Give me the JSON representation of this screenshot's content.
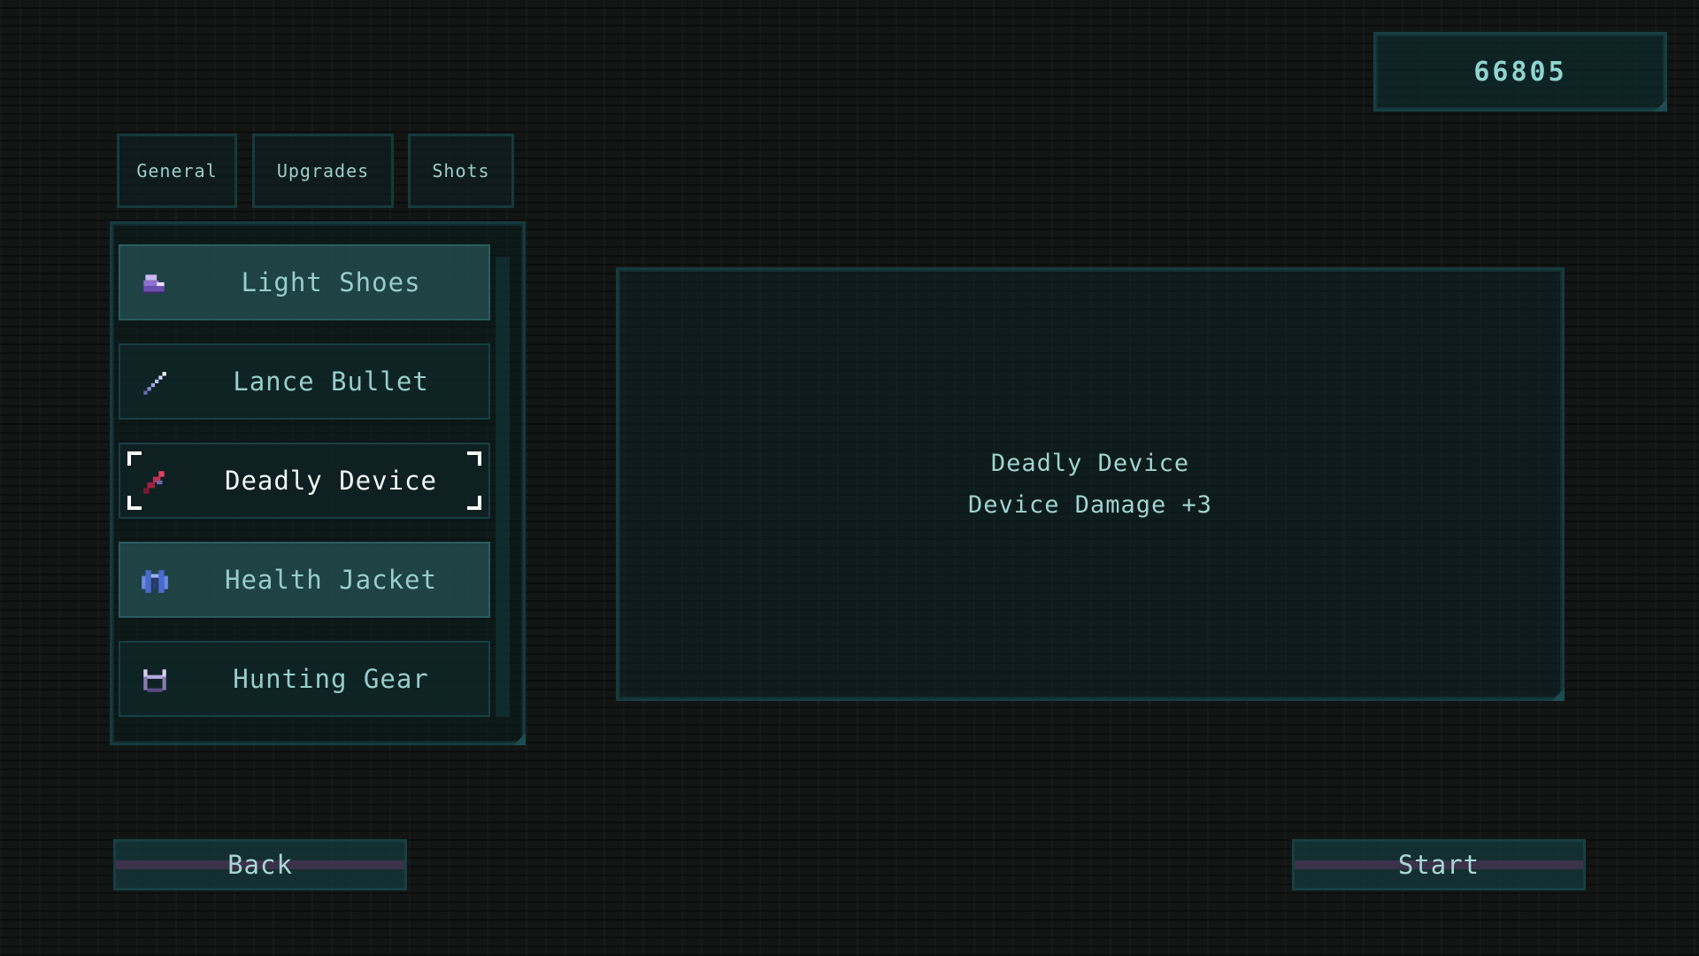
{
  "score": "66805",
  "tabs": [
    {
      "label": "General"
    },
    {
      "label": "Upgrades"
    },
    {
      "label": "Shots"
    }
  ],
  "items": [
    {
      "label": "Light Shoes",
      "icon": "shoe-icon",
      "state": "highlighted"
    },
    {
      "label": "Lance Bullet",
      "icon": "lance-icon",
      "state": "normal"
    },
    {
      "label": "Deadly Device",
      "icon": "device-icon",
      "state": "selected"
    },
    {
      "label": "Health Jacket",
      "icon": "jacket-icon",
      "state": "highlighted"
    },
    {
      "label": "Hunting Gear",
      "icon": "horns-icon",
      "state": "normal"
    }
  ],
  "description": {
    "title": "Deadly Device",
    "effect": "Device Damage +3"
  },
  "buttons": {
    "back": "Back",
    "start": "Start"
  },
  "colors": {
    "accent": "#9fd3cf",
    "panel_border": "#143b3e",
    "selected_text": "#f1f7f6"
  }
}
